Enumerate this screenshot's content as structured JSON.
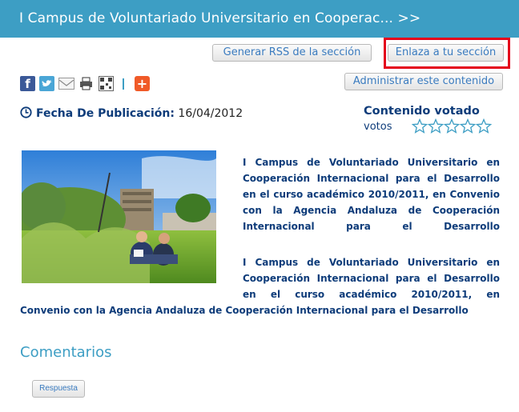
{
  "header": {
    "title": "I Campus de Voluntariado Universitario en Cooperac... >>"
  },
  "toolbar": {
    "rss_label": "Generar RSS de la sección",
    "link_label": "Enlaza a tu sección",
    "admin_label": "Administrar este contenido"
  },
  "share_icons": [
    "facebook-icon",
    "twitter-icon",
    "email-icon",
    "print-icon",
    "qr-code-icon",
    "add-plus-icon"
  ],
  "article": {
    "date_label": "Fecha De Publicación:",
    "date_value": "16/04/2012",
    "voted_title": "Contenido votado",
    "votes_label": "votos",
    "rating": {
      "value": 0,
      "max": 5
    },
    "para1": "I Campus de Voluntariado Universitario en Cooperación Internacional para el Desarrollo en el curso académico 2010/2011, en Convenio con la Agencia Andaluza de Cooperación Internacional para el Desarrollo",
    "para2_part1": "I Campus de Voluntariado Universitario en Cooperación Internacional para el Desarrollo en el curso académico 2010/2011, en",
    "para2_part2": "Convenio con la Agencia Andaluza de Cooperación Internacional para el Desarrollo"
  },
  "comments": {
    "title": "Comentarios",
    "reply_label": "Respuesta"
  },
  "colors": {
    "header_bg": "#3d9ec4",
    "text_dark_blue": "#0e3c7a",
    "highlight_red": "#e4001b"
  }
}
